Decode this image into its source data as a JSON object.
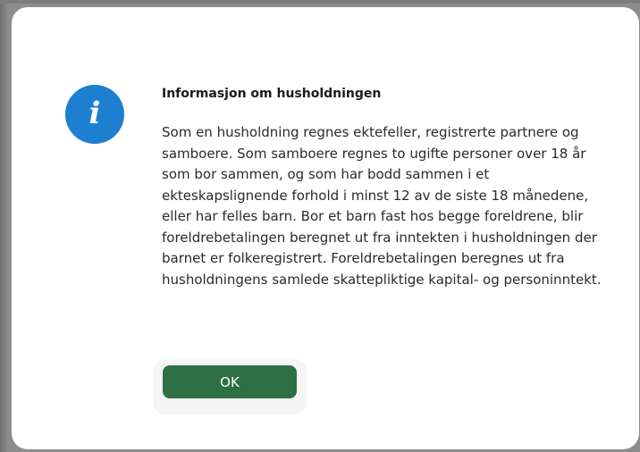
{
  "dialog": {
    "icon": "info-icon",
    "icon_glyph": "i",
    "title": "Informasjon om husholdningen",
    "body": "Som en husholdning regnes ektefeller, registrerte partnere og samboere. Som samboere regnes to ugifte personer over 18 år som bor sammen, og som har bodd sammen i et ekteskapslignende forhold i minst 12 av de siste 18 månedene, eller har felles barn. Bor et barn fast hos begge foreldrene, blir foreldrebetalingen beregnet ut fra inntekten i husholdningen der barnet er folkeregistrert. Foreldrebetalingen beregnes ut fra husholdningens samlede skattepliktige kapital- og personinntekt.",
    "ok_label": "OK"
  },
  "colors": {
    "icon_background": "#1c7fd0",
    "ok_button": "#2e6f43",
    "overlay": "#8d8d8d"
  }
}
